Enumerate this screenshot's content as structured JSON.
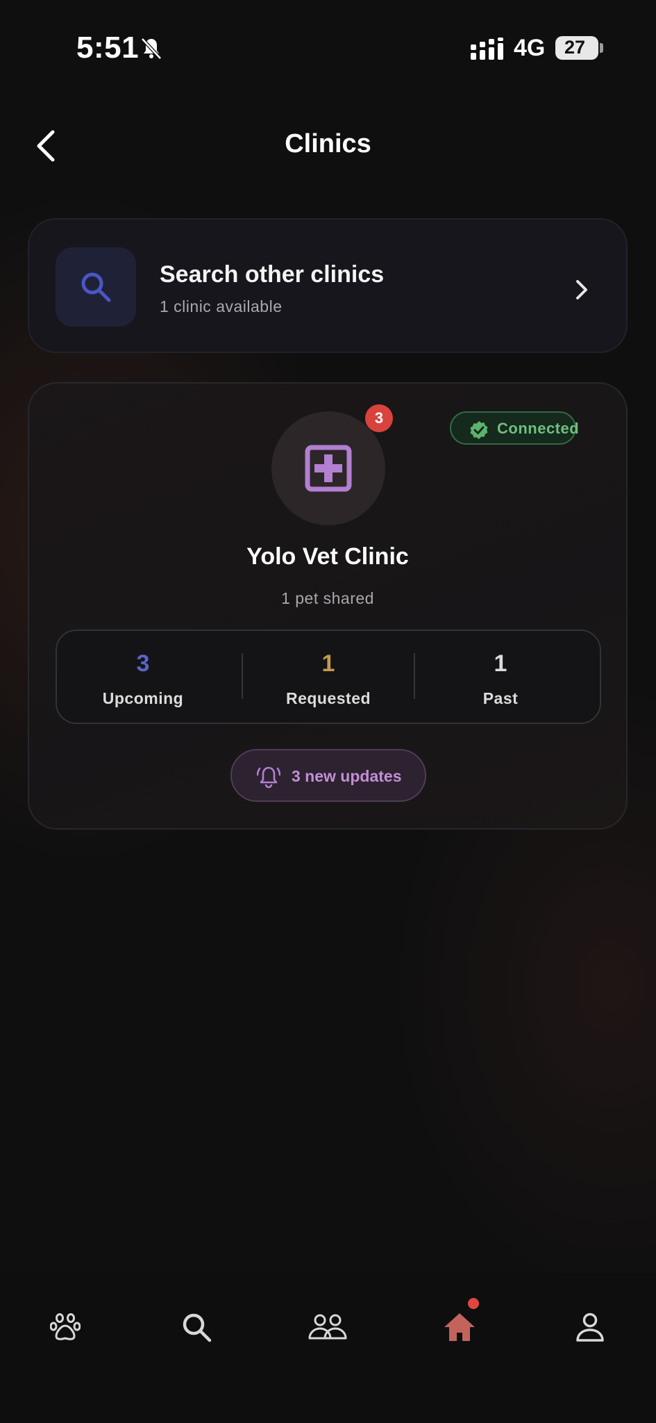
{
  "status_bar": {
    "time": "5:51",
    "network": "4G",
    "battery": "27"
  },
  "header": {
    "title": "Clinics"
  },
  "search_card": {
    "title": "Search other clinics",
    "subtitle": "1 clinic available"
  },
  "clinic": {
    "name": "Yolo Vet Clinic",
    "subtitle": "1 pet shared",
    "badge_count": "3",
    "status": "Connected",
    "stats": [
      {
        "value": "3",
        "label": "Upcoming",
        "color": "#5b63c9"
      },
      {
        "value": "1",
        "label": "Requested",
        "color": "#c39a4f"
      },
      {
        "value": "1",
        "label": "Past",
        "color": "#dcdcdc"
      }
    ],
    "updates_label": "3 new updates"
  },
  "nav": {
    "items": [
      "paw-icon",
      "search-icon",
      "people-icon",
      "home-icon",
      "profile-icon"
    ],
    "active": "home-icon"
  },
  "colors": {
    "accent_purple": "#b27fd1",
    "accent_blue": "#4b56c6",
    "connected_green": "#6fbf7f",
    "alert_red": "#d8433d",
    "home_active": "#c2645c"
  }
}
